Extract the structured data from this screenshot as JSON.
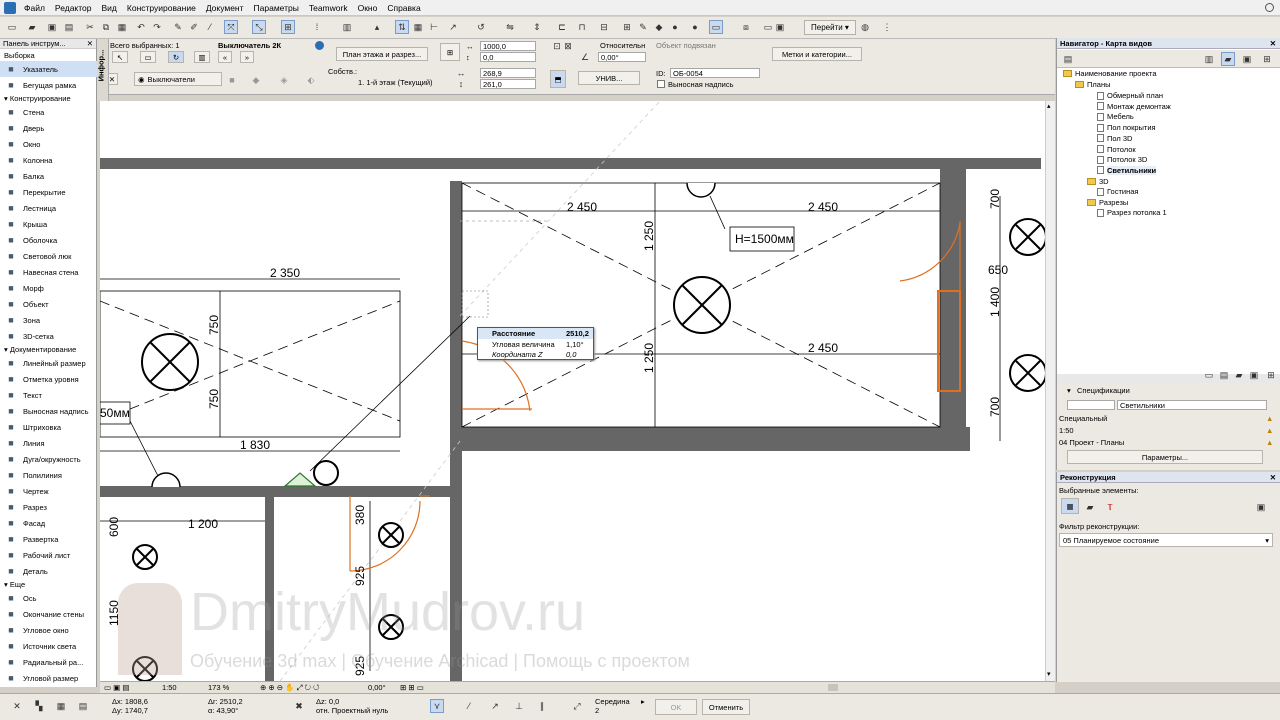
{
  "menu": [
    "Файл",
    "Редактор",
    "Вид",
    "Конструирование",
    "Документ",
    "Параметры",
    "Teamwork",
    "Окно",
    "Справка"
  ],
  "toolbar": {
    "goto_label": "Перейти"
  },
  "info_box": {
    "selected_count": "Всего выбранных: 1",
    "element_name": "Выключатель 2К",
    "plan_section_btn": "План этажа и разрез...",
    "width": "1000,0",
    "depth": "0,0",
    "relative_label": "Относительн",
    "object_label": "Объект подвязан",
    "angle": "0,00°",
    "labels_btn": "Метки и категории...",
    "switches_label": "Выключатели",
    "story_label": "Собств.:",
    "story_value": "1. 1-й этаж (Текущий)",
    "dim1": "268,9",
    "dim2": "261,0",
    "univ_btn": "УНИВ...",
    "id_label": "ID:",
    "id_value": "ОБ-0054",
    "callout_label": "Выносная надпись",
    "side_tab": "Инфор..."
  },
  "left_panel": {
    "title": "Панель инструм...",
    "select_section": "Выборка",
    "select_items": [
      {
        "label": "Указатель",
        "icon": "arrow-pointer-icon"
      },
      {
        "label": "Бегущая рамка",
        "icon": "marquee-icon"
      }
    ],
    "construct_section": "Конструирование",
    "construct_items": [
      {
        "label": "Стена",
        "icon": "wall-icon"
      },
      {
        "label": "Дверь",
        "icon": "door-icon"
      },
      {
        "label": "Окно",
        "icon": "window-icon"
      },
      {
        "label": "Колонна",
        "icon": "column-icon"
      },
      {
        "label": "Балка",
        "icon": "beam-icon"
      },
      {
        "label": "Перекрытие",
        "icon": "slab-icon"
      },
      {
        "label": "Лестница",
        "icon": "stair-icon"
      },
      {
        "label": "Крыша",
        "icon": "roof-icon"
      },
      {
        "label": "Оболочка",
        "icon": "shell-icon"
      },
      {
        "label": "Световой люк",
        "icon": "skylight-icon"
      },
      {
        "label": "Навесная стена",
        "icon": "curtain-wall-icon"
      },
      {
        "label": "Морф",
        "icon": "morph-icon"
      },
      {
        "label": "Объект",
        "icon": "object-icon"
      },
      {
        "label": "Зона",
        "icon": "zone-icon"
      },
      {
        "label": "3D-сетка",
        "icon": "mesh-icon"
      }
    ],
    "document_section": "Документирование",
    "document_items": [
      {
        "label": "Линейный размер",
        "icon": "dimension-icon"
      },
      {
        "label": "Отметка уровня",
        "icon": "level-icon"
      },
      {
        "label": "Текст",
        "icon": "text-icon"
      },
      {
        "label": "Выносная надпись",
        "icon": "label-icon"
      },
      {
        "label": "Штриховка",
        "icon": "fill-icon"
      },
      {
        "label": "Линия",
        "icon": "line-icon"
      },
      {
        "label": "Дуга/окружность",
        "icon": "arc-icon"
      },
      {
        "label": "Полилиния",
        "icon": "polyline-icon"
      },
      {
        "label": "Чертеж",
        "icon": "drawing-icon"
      },
      {
        "label": "Разрез",
        "icon": "section-icon"
      },
      {
        "label": "Фасад",
        "icon": "elevation-icon"
      },
      {
        "label": "Развертка",
        "icon": "interior-elevation-icon"
      },
      {
        "label": "Рабочий лист",
        "icon": "worksheet-icon"
      },
      {
        "label": "Деталь",
        "icon": "detail-icon"
      }
    ],
    "more_section": "Еще",
    "more_items": [
      {
        "label": "Ось",
        "icon": "grid-icon"
      },
      {
        "label": "Окончание стены",
        "icon": "wall-end-icon"
      },
      {
        "label": "Угловое окно",
        "icon": "corner-window-icon"
      },
      {
        "label": "Источник света",
        "icon": "lamp-icon"
      },
      {
        "label": "Радиальный ра...",
        "icon": "radial-dimension-icon"
      },
      {
        "label": "Угловой размер",
        "icon": "angle-dimension-icon"
      }
    ]
  },
  "drawing": {
    "dims": {
      "d1": "2 450",
      "d2": "2 450",
      "d3": "2 350",
      "d4": "1 250",
      "d5": "1 250",
      "d6": "2 450",
      "d7": "700",
      "d8": "650",
      "d9": "1 400",
      "d10": "700",
      "d11": "750",
      "d12": "750",
      "d13": "1 830",
      "d14": "1 200",
      "d15": "600",
      "d16": "380",
      "d17": "925",
      "d18": "925",
      "d19": "1150"
    },
    "height_tag": "H=1500мм",
    "height_tag2": "50мм"
  },
  "tracker": {
    "rows": [
      {
        "label": "Расстояние",
        "value": "2510,2"
      },
      {
        "label": "Угловая величина",
        "value": "1,10°"
      },
      {
        "label": "Координата Z",
        "value": "0,0"
      }
    ]
  },
  "status": {
    "scale": "1:50",
    "zoom": "173 %",
    "angle": "0,00°"
  },
  "bottom": {
    "dx": "Δx: 1808,6",
    "dy": "Δy: 1740,7",
    "dr": "Δr: 2510,2",
    "da": "α: 43,90°",
    "dz": "Δz: 0,0",
    "ref": "отн. Проектный нуль",
    "snap": "Середина",
    "snap_n": "2",
    "ok_btn": "OK",
    "cancel_btn": "Отменить"
  },
  "navigator": {
    "title": "Навигатор - Карта видов",
    "project": "Наименование проекта",
    "plans_folder": "Планы",
    "plans": [
      "Обмерный план",
      "Монтаж демонтаж",
      "Мебель",
      "Пол покрытия",
      "Пол 3D",
      "Потолок",
      "Потолок 3D",
      "Светильники"
    ],
    "folder_3d": "3D",
    "item_3d": "Гостиная",
    "sections_folder": "Разрезы",
    "section_item": "Разрез потолка 1"
  },
  "specs": {
    "title": "Спецификации",
    "name_value": "Светильники",
    "rows": [
      "Специальный",
      "1:50",
      "04 Проект - Планы"
    ],
    "params_btn": "Параметры..."
  },
  "reconstruction": {
    "title": "Реконструкция",
    "selected_label": "Выбранные элементы:",
    "filter_label": "Фильтр реконструкции:",
    "filter_value": "05 Планируемое состояние"
  },
  "watermark": {
    "title": "DmitryMudrov.ru",
    "subtitle": "Обучение 3d max | Обучение Archicad | Помощь с проектом"
  }
}
